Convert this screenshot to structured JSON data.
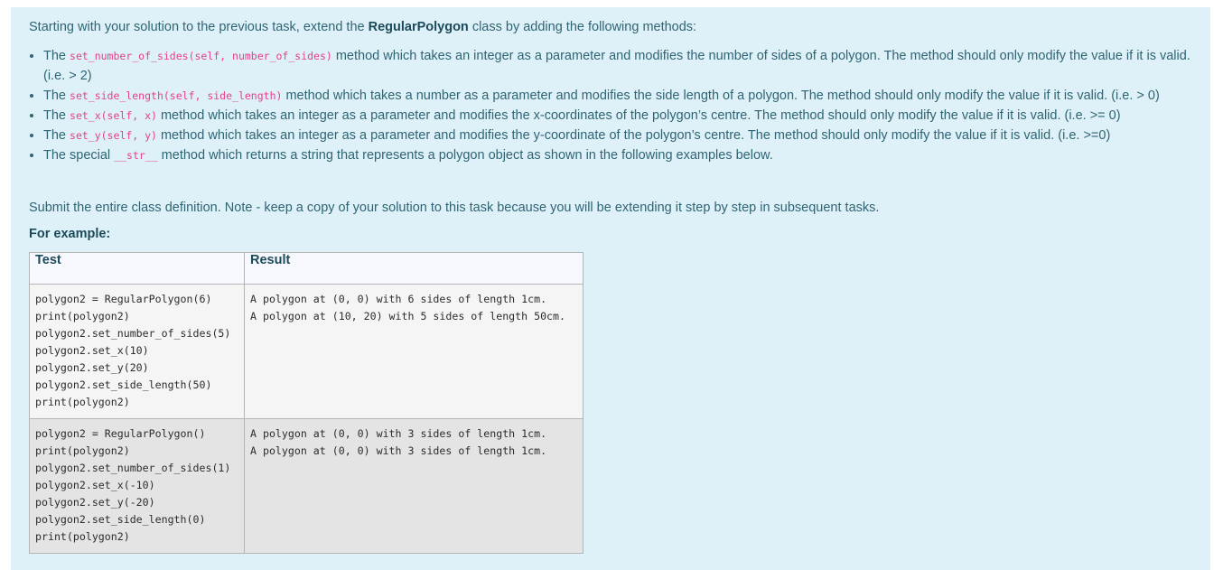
{
  "question": {
    "intro_before": "Starting with your solution to the previous task, extend the ",
    "intro_class": "RegularPolygon",
    "intro_after": " class by adding the following methods:",
    "methods": [
      {
        "prefix": "The ",
        "code": "set_number_of_sides(self, number_of_sides)",
        "text": " method which takes an integer as a parameter and modifies the number of sides of a polygon. The method should only modify the value if it is valid. (i.e. > 2)"
      },
      {
        "prefix": "The ",
        "code": "set_side_length(self, side_length)",
        "text": " method which takes a number as a parameter and modifies the side length of a polygon. The method should only modify the value if it is valid. (i.e. > 0)"
      },
      {
        "prefix": "The ",
        "code": "set_x(self, x)",
        "text": " method which takes an integer as a parameter and modifies the x-coordinates of the polygon’s centre. The method should only modify the value if it is valid. (i.e. >= 0)"
      },
      {
        "prefix": "The ",
        "code": "set_y(self, y)",
        "text": " method which takes an integer as a parameter and modifies the y-coordinate of the polygon’s centre. The method should only modify the value if it is valid. (i.e. >=0)"
      },
      {
        "prefix": "The special ",
        "code": "__str__",
        "text": " method which returns a string that represents a polygon object as shown in the following examples below."
      }
    ],
    "submit_note": "Submit the entire class definition. Note - keep a copy of your solution to this task because you will be extending it step by step in subsequent tasks.",
    "for_example": "For example:"
  },
  "examples_table": {
    "headers": [
      "Test",
      "Result"
    ],
    "rows": [
      {
        "test": "polygon2 = RegularPolygon(6)\nprint(polygon2)\npolygon2.set_number_of_sides(5)\npolygon2.set_x(10)\npolygon2.set_y(20)\npolygon2.set_side_length(50)\nprint(polygon2)",
        "result": "A polygon at (0, 0) with 6 sides of length 1cm.\nA polygon at (10, 20) with 5 sides of length 50cm."
      },
      {
        "test": "polygon2 = RegularPolygon()\nprint(polygon2)\npolygon2.set_number_of_sides(1)\npolygon2.set_x(-10)\npolygon2.set_y(-20)\npolygon2.set_side_length(0)\nprint(polygon2)",
        "result": "A polygon at (0, 0) with 3 sides of length 1cm.\nA polygon at (0, 0) with 3 sides of length 1cm."
      }
    ]
  }
}
